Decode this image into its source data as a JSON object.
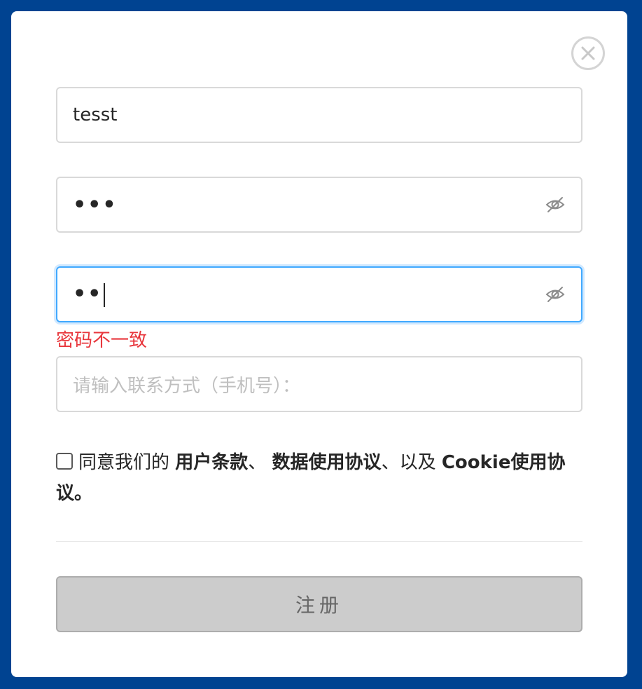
{
  "colors": {
    "background": "#004391",
    "error": "#e8373d",
    "focus_border": "#40a9ff",
    "disabled_button_bg": "#cccccc"
  },
  "close": {
    "icon": "close-circle-icon"
  },
  "form": {
    "username": {
      "value": "tesst"
    },
    "password": {
      "value": "•••",
      "toggle_icon": "eye-invisible-icon"
    },
    "confirm_password": {
      "value": "••",
      "toggle_icon": "eye-invisible-icon",
      "focused": true
    },
    "error_message": "密码不一致",
    "phone": {
      "value": "",
      "placeholder": "请输入联系方式（手机号）："
    }
  },
  "agreement": {
    "checked": false,
    "prefix": "同意我们的 ",
    "terms": "用户条款",
    "sep1": "、 ",
    "data_policy": "数据使用协议",
    "sep2": "、以及 ",
    "cookie_policy": "Cookie使用协议",
    "suffix": "。"
  },
  "submit": {
    "label": "注册"
  }
}
